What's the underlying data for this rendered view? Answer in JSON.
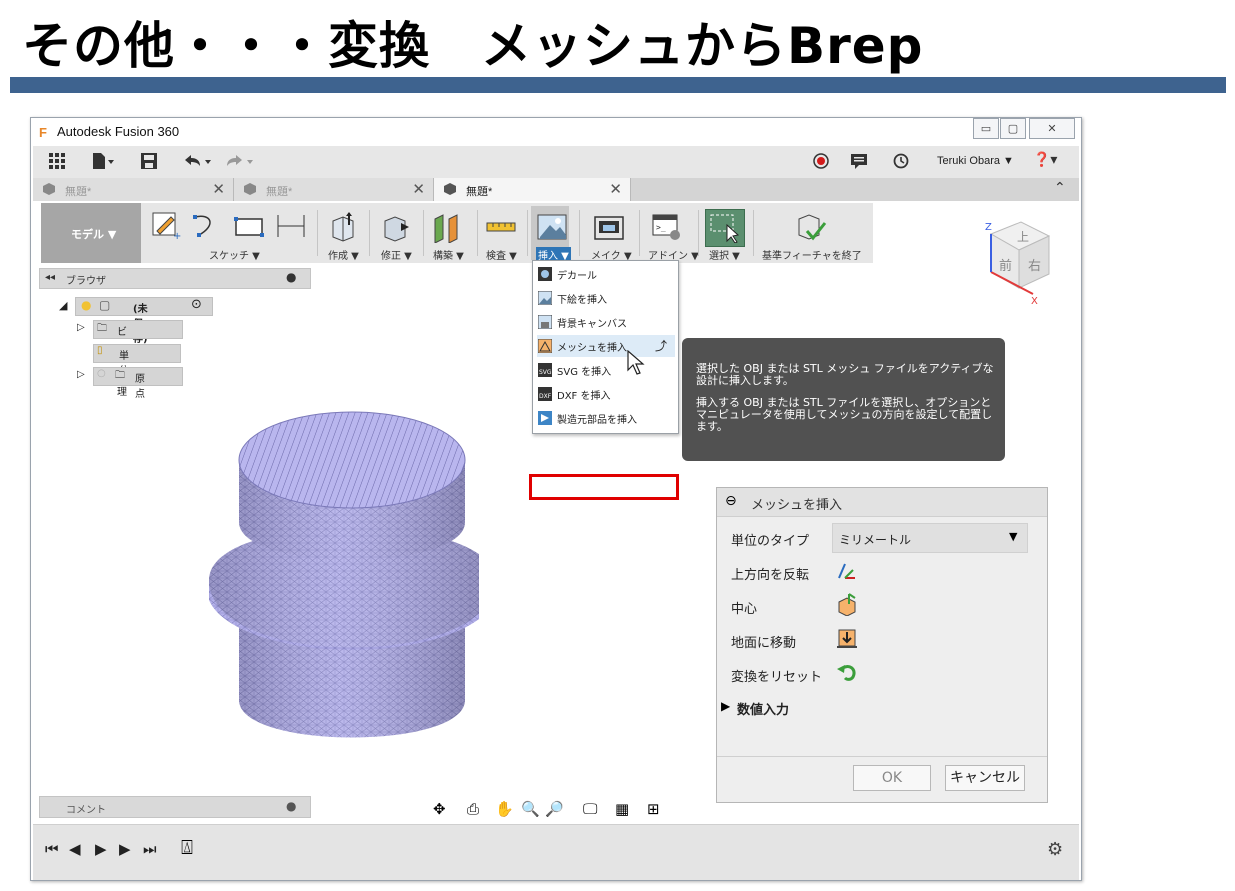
{
  "slide": {
    "title": "その他・・・変換　メッシュからBrep"
  },
  "app": {
    "title": "Autodesk Fusion 360",
    "logo_letter": "F",
    "window_buttons": [
      "▭",
      "▢",
      "✕"
    ]
  },
  "toolbar": {
    "user": "Teruki Obara ▼",
    "help": "❓▾"
  },
  "tabs": [
    {
      "label": "無題*",
      "active": false
    },
    {
      "label": "無題*",
      "active": false
    },
    {
      "label": "無題*",
      "active": true
    }
  ],
  "ribbon": {
    "workspace": "モデル ▼",
    "groups": [
      "スケッチ ▼",
      "作成 ▼",
      "修正 ▼",
      "構築 ▼",
      "検査 ▼",
      "挿入 ▼",
      "メイク ▼",
      "アドイン ▼",
      "選択 ▼",
      "基準フィーチャを終了"
    ]
  },
  "browser": {
    "title": "ブラウザ",
    "root": "(未保存)",
    "items": [
      "ビュー管理",
      "単位: mm",
      "原点"
    ]
  },
  "insert_menu": {
    "items": [
      "デカール",
      "下絵を挿入",
      "背景キャンバス",
      "メッシュを挿入",
      "SVG を挿入",
      "DXF を挿入",
      "製造元部品を挿入"
    ]
  },
  "tooltip": {
    "line1": "選択した OBJ または STL メッシュ ファイルをアクティブな",
    "line2": "設計に挿入します。",
    "line3": "挿入する OBJ または STL ファイルを選択し、オプションと",
    "line4": "マニピュレータを使用してメッシュの方向を設定して配置し",
    "line5": "ます。"
  },
  "panel": {
    "title": "メッシュを挿入",
    "unit_label": "単位のタイプ",
    "unit_value": "ミリメートル",
    "flip_label": "上方向を反転",
    "center_label": "中心",
    "ground_label": "地面に移動",
    "reset_label": "変換をリセット",
    "numeric_label": "数値入力",
    "ok": "OK",
    "cancel": "キャンセル"
  },
  "viewcube": {
    "top": "上",
    "front": "前",
    "right": "右",
    "axis_x": "X",
    "axis_z": "Z"
  },
  "comment": {
    "label": "コメント"
  },
  "colors": {
    "slide_stripe": "#3e638f",
    "highlight": "#e00000",
    "mesh_fill": "#b9b6ee",
    "tooltip_bg": "#515151"
  }
}
